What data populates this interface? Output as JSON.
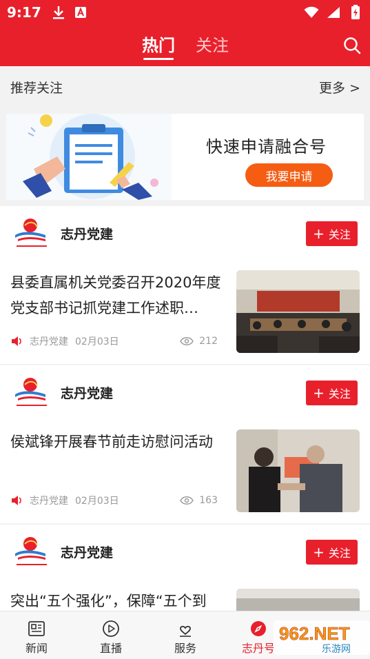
{
  "status_bar": {
    "time": "9:17"
  },
  "top_nav": {
    "tabs": [
      {
        "label": "热门"
      },
      {
        "label": "关注"
      }
    ]
  },
  "recommend": {
    "title": "推荐关注",
    "more": "更多 >"
  },
  "banner": {
    "headline": "快速申请融合号",
    "button": "我要申请"
  },
  "cards": [
    {
      "source": "志丹党建",
      "follow": "关注",
      "headline": "县委直属机关党委召开2020年度党支部书记抓党建工作述职…",
      "meta_source": "志丹党建",
      "date": "02月03日",
      "views": "212"
    },
    {
      "source": "志丹党建",
      "follow": "关注",
      "headline": "侯斌锋开展春节前走访慰问活动",
      "meta_source": "志丹党建",
      "date": "02月03日",
      "views": "163"
    },
    {
      "source": "志丹党建",
      "follow": "关注",
      "headline": "突出“五个强化”，保障“五个到"
    }
  ],
  "bottom_nav": {
    "items": [
      {
        "label": "新闻"
      },
      {
        "label": "直播"
      },
      {
        "label": "服务"
      },
      {
        "label": "志丹号"
      }
    ]
  },
  "watermark": {
    "text": "962.NET",
    "sub": "乐游网"
  },
  "colors": {
    "primary": "#e8202c",
    "accent_orange": "#f55d13",
    "meta_gray": "#999999"
  }
}
